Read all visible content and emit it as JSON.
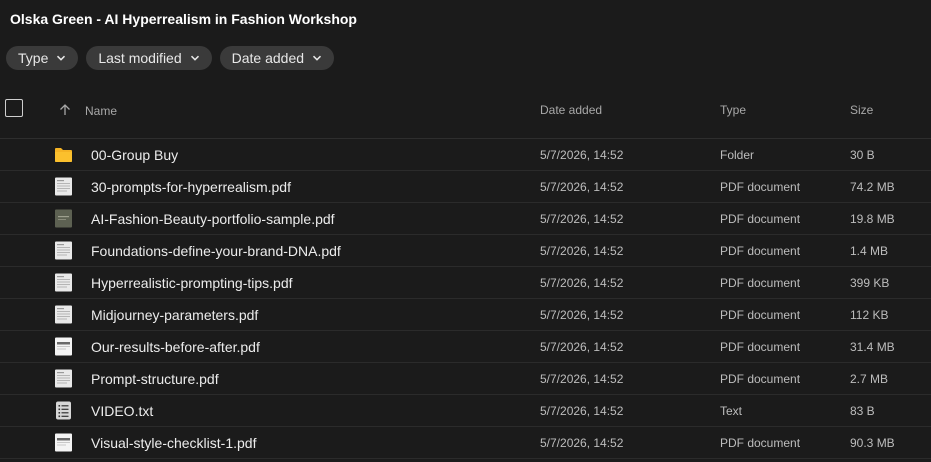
{
  "title": "Olska Green - AI Hyperrealism in Fashion Workshop",
  "filters": [
    {
      "label": "Type",
      "icon": "chevron-down-icon"
    },
    {
      "label": "Last modified",
      "icon": "chevron-down-icon"
    },
    {
      "label": "Date added",
      "icon": "chevron-down-icon"
    }
  ],
  "columns": {
    "name": "Name",
    "date_added": "Date added",
    "type": "Type",
    "size": "Size",
    "sort_icon": "arrow-up-icon"
  },
  "colors": {
    "background": "#1b1b1b",
    "chip": "#3a3a3a",
    "folder": "#f5b324"
  },
  "files": [
    {
      "name": "00-Group Buy",
      "date": "5/7/2026, 14:52",
      "type": "Folder",
      "size": "30 B",
      "icon": "folder"
    },
    {
      "name": "30-prompts-for-hyperrealism.pdf",
      "date": "5/7/2026, 14:52",
      "type": "PDF document",
      "size": "74.2 MB",
      "icon": "doc"
    },
    {
      "name": "AI-Fashion-Beauty-portfolio-sample.pdf",
      "date": "5/7/2026, 14:52",
      "type": "PDF document",
      "size": "19.8 MB",
      "icon": "photo"
    },
    {
      "name": "Foundations-define-your-brand-DNA.pdf",
      "date": "5/7/2026, 14:52",
      "type": "PDF document",
      "size": "1.4 MB",
      "icon": "doc"
    },
    {
      "name": "Hyperrealistic-prompting-tips.pdf",
      "date": "5/7/2026, 14:52",
      "type": "PDF document",
      "size": "399 KB",
      "icon": "doc"
    },
    {
      "name": "Midjourney-parameters.pdf",
      "date": "5/7/2026, 14:52",
      "type": "PDF document",
      "size": "112 KB",
      "icon": "doc"
    },
    {
      "name": "Our-results-before-after.pdf",
      "date": "5/7/2026, 14:52",
      "type": "PDF document",
      "size": "31.4 MB",
      "icon": "doc-light"
    },
    {
      "name": "Prompt-structure.pdf",
      "date": "5/7/2026, 14:52",
      "type": "PDF document",
      "size": "2.7 MB",
      "icon": "doc"
    },
    {
      "name": "VIDEO.txt",
      "date": "5/7/2026, 14:52",
      "type": "Text",
      "size": "83 B",
      "icon": "text"
    },
    {
      "name": "Visual-style-checklist-1.pdf",
      "date": "5/7/2026, 14:52",
      "type": "PDF document",
      "size": "90.3 MB",
      "icon": "doc-light"
    }
  ]
}
